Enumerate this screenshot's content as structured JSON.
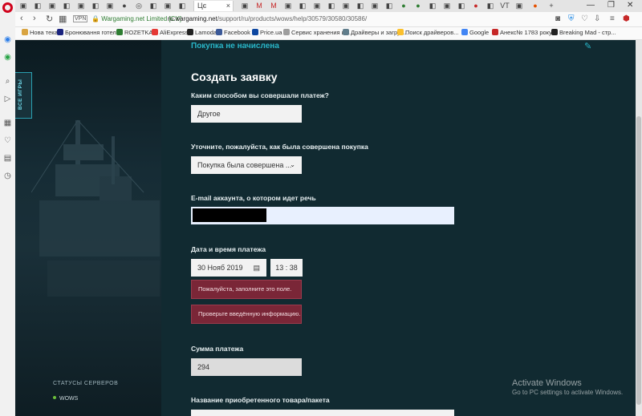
{
  "browser": {
    "active_tab_title": "Цє",
    "secure_label": "Wargaming.net Limited [CY]",
    "url_host": "ru.wargaming.net",
    "url_path": "/support/ru/products/wows/help/30579/30580/30586/",
    "vpn_badge": "VPN",
    "bookmarks": [
      "Нова тека",
      "Бронювання готелів",
      "ROZETKA",
      "AliExpress",
      "Lamoda",
      "Facebook",
      "Price.ua",
      "Сервис хранения и...",
      "Драйверы и загруз...",
      "Поиск драйверов...",
      "Google",
      "Анекс№ 1783 року...",
      "Breaking Mad - стр..."
    ]
  },
  "sidebar": {
    "games_tab": "ВСЕ ИГРЫ",
    "servers_title": "СТАТУСЫ СЕРВЕРОВ",
    "server_item": "WOWS"
  },
  "form": {
    "top_link": "Покупка не начислена",
    "title": "Создать заявку",
    "q_method": "Каким способом вы совершали платеж?",
    "method_value": "Другое",
    "q_how": "Уточните, пожалуйста, как была совершена покупка",
    "how_value": "Покупка была совершена ...",
    "q_email": "E-mail аккаунта, о котором идет речь",
    "q_datetime": "Дата и время платежа",
    "date_value": "30 Нояб 2019",
    "time_value": "13 : 38",
    "err_fill": "Пожалуйста, заполните это поле.",
    "err_check": "Проверьте введённую информацию.",
    "q_amount": "Сумма платежа",
    "amount_value": "294",
    "q_product": "Название приобретенного товара/пакета"
  },
  "watermark": {
    "line1": "Activate Windows",
    "line2": "Go to PC settings to activate Windows."
  }
}
